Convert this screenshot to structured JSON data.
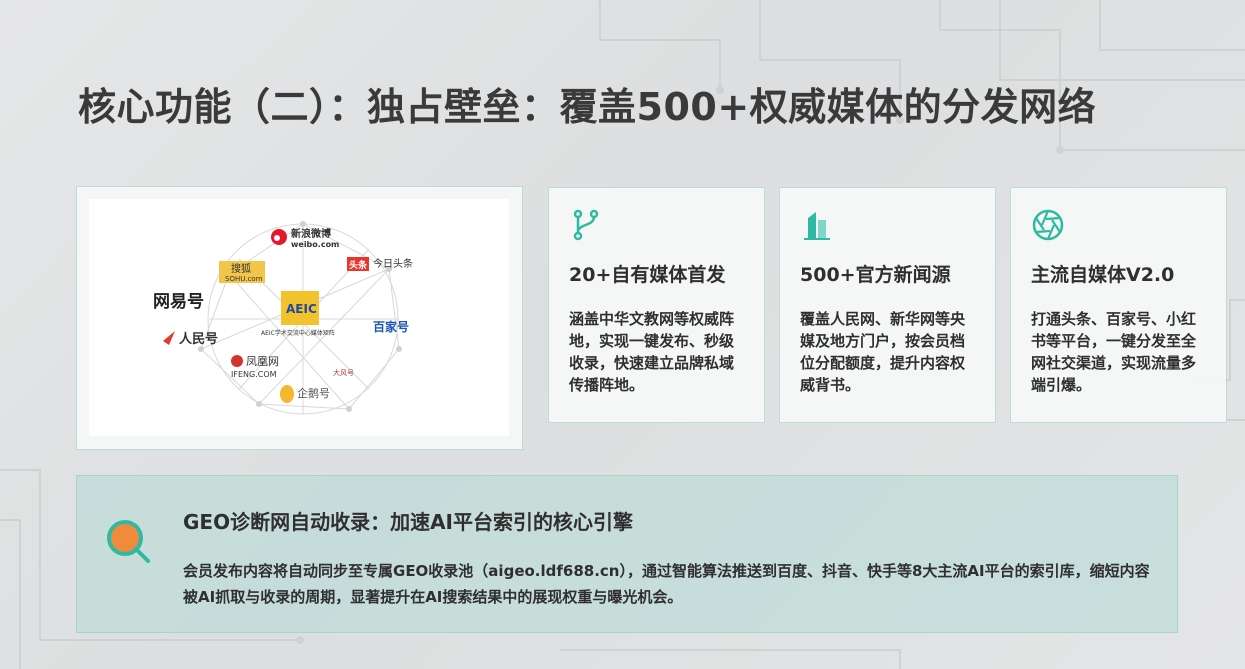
{
  "title": "核心功能（二）：独占壁垒：覆盖500+权威媒体的分发网络",
  "accent_color": "#2fb9a3",
  "secondary_accent": "#f08a3c",
  "logo_panel": {
    "center_logo": "AEIC",
    "center_caption": "AEIC学术交流中心媒体矩阵",
    "logos": [
      {
        "name": "新浪微博",
        "sub": "weibo.com"
      },
      {
        "name": "搜狐",
        "sub": "SOHU.com"
      },
      {
        "name": "头条",
        "sub": "今日头条"
      },
      {
        "name": "网易号"
      },
      {
        "name": "人民号"
      },
      {
        "name": "百家号"
      },
      {
        "name": "凤凰网",
        "sub": "IFENG.COM"
      },
      {
        "name": "大风号"
      },
      {
        "name": "企鹅号"
      }
    ]
  },
  "features": [
    {
      "icon": "branch-icon",
      "title": "20+自有媒体首发",
      "body": "涵盖中华文教网等权威阵地，实现一键发布、秒级收录，快速建立品牌私域传播阵地。"
    },
    {
      "icon": "buildings-icon",
      "title": "500+官方新闻源",
      "body": "覆盖人民网、新华网等央媒及地方门户，按会员档位分配额度，提升内容权威背书。"
    },
    {
      "icon": "aperture-icon",
      "title": "主流自媒体V2.0",
      "body": "打通头条、百家号、小红书等平台，一键分发至全网社交渠道，实现流量多端引爆。"
    }
  ],
  "bottom": {
    "icon": "magnifier-icon",
    "title": "GEO诊断网自动收录：加速AI平台索引的核心引擎",
    "body": "会员发布内容将自动同步至专属GEO收录池（aigeo.ldf688.cn），通过智能算法推送到百度、抖音、快手等8大主流AI平台的索引库，缩短内容被AI抓取与收录的周期，显著提升在AI搜索结果中的展现权重与曝光机会。"
  }
}
